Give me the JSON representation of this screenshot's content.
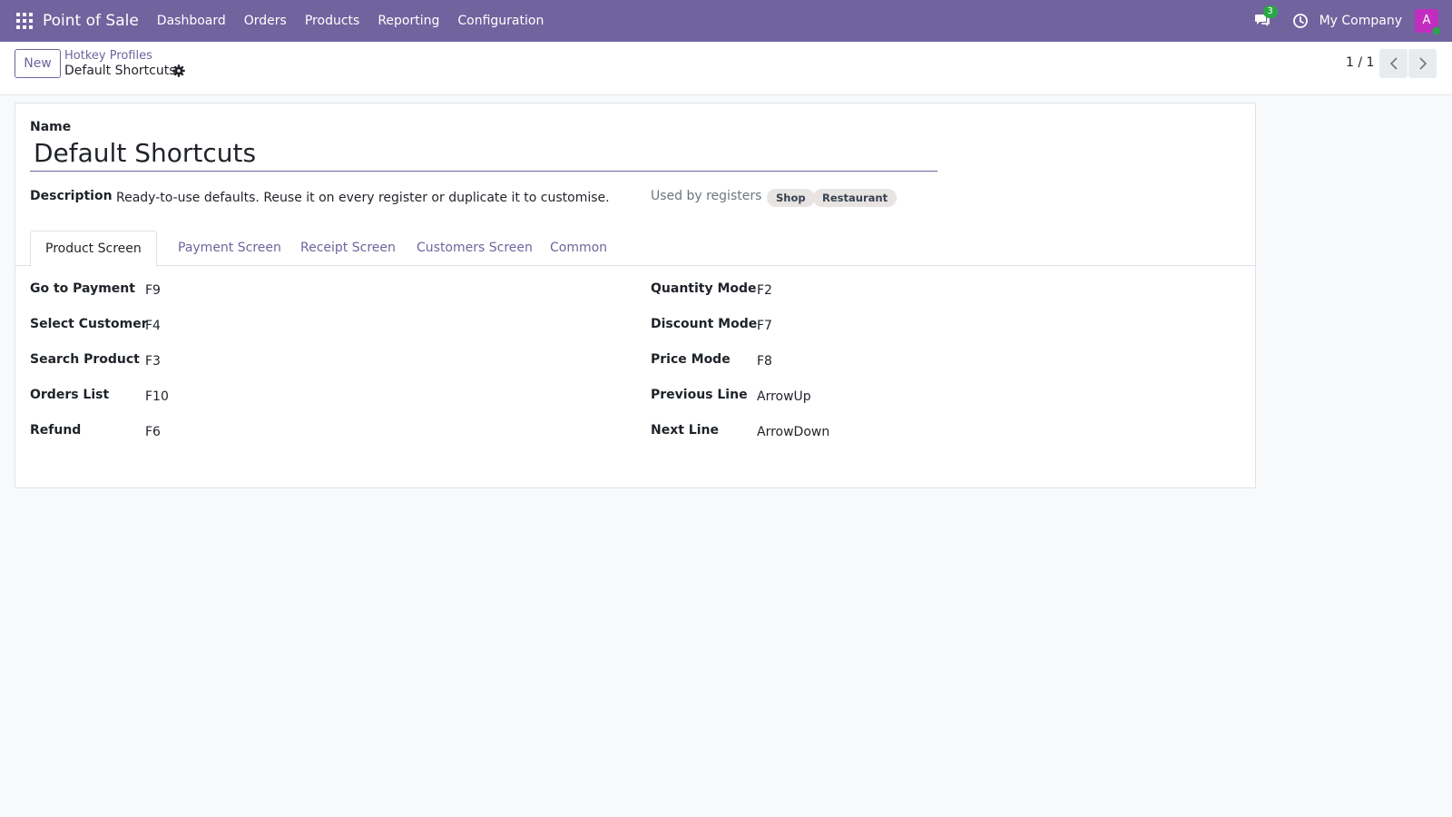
{
  "navbar": {
    "app_name": "Point of Sale",
    "menu": [
      "Dashboard",
      "Orders",
      "Products",
      "Reporting",
      "Configuration"
    ],
    "chat_count": "3",
    "company": "My Company",
    "avatar_initial": "A",
    "brand_color": "#71639e"
  },
  "control_panel": {
    "new_label": "New",
    "breadcrumb_parent": "Hotkey Profiles",
    "breadcrumb_current": "Default Shortcuts",
    "pager": "1 / 1"
  },
  "form": {
    "name_label": "Name",
    "name_value": "Default Shortcuts",
    "description_label": "Description",
    "description_value": "Ready-to-use defaults. Reuse it on every register or duplicate it to customise.",
    "registers_label": "Used by registers",
    "registers": [
      "Shop",
      "Restaurant"
    ],
    "tabs": [
      "Product Screen",
      "Payment Screen",
      "Receipt Screen",
      "Customers Screen",
      "Common"
    ],
    "active_tab": "Product Screen",
    "left_fields": [
      {
        "label": "Go to Payment",
        "value": "F9"
      },
      {
        "label": "Select Customer",
        "value": "F4"
      },
      {
        "label": "Search Product",
        "value": "F3"
      },
      {
        "label": "Orders List",
        "value": "F10"
      },
      {
        "label": "Refund",
        "value": "F6"
      }
    ],
    "right_fields": [
      {
        "label": "Quantity Mode",
        "value": "F2"
      },
      {
        "label": "Discount Mode",
        "value": "F7"
      },
      {
        "label": "Price Mode",
        "value": "F8"
      },
      {
        "label": "Previous Line",
        "value": "ArrowUp"
      },
      {
        "label": "Next Line",
        "value": "ArrowDown"
      }
    ]
  }
}
